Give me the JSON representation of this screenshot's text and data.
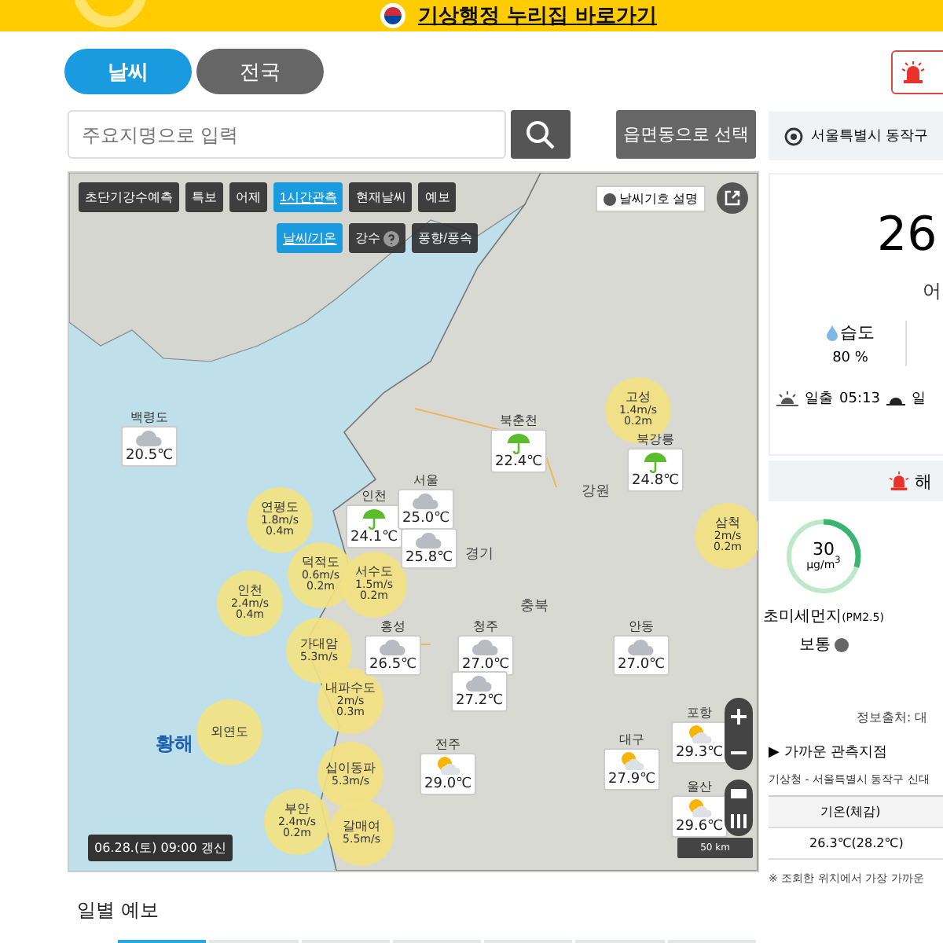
{
  "banner": {
    "link": "기상행정 누리집 바로가기"
  },
  "tabs": [
    {
      "label": "날씨",
      "selected": true
    },
    {
      "label": "전국",
      "selected": false
    }
  ],
  "search": {
    "placeholder": "주요지명으로 입력"
  },
  "region_button": "읍면동으로 선택",
  "location": "서울특별시 동작구",
  "map": {
    "toolbar": [
      {
        "label": "초단기강수예측",
        "selected": false
      },
      {
        "label": "특보",
        "selected": false
      },
      {
        "label": "어제",
        "selected": false
      },
      {
        "label": "1시간관측",
        "selected": true
      },
      {
        "label": "현재날씨",
        "selected": false
      },
      {
        "label": "예보",
        "selected": false
      }
    ],
    "subtoolbar": [
      {
        "label": "날씨/기온",
        "selected": true,
        "help": false
      },
      {
        "label": "강수",
        "selected": false,
        "help": true
      },
      {
        "label": "풍향/풍속",
        "selected": false,
        "help": false
      }
    ],
    "legend_button": "날씨기호 설명",
    "stations": [
      {
        "name": "백령도",
        "temp": "20.5℃",
        "kind": "cloudy"
      },
      {
        "name": "북춘천",
        "temp": "22.4℃",
        "kind": "rain"
      },
      {
        "name": "북강릉",
        "temp": "24.8℃",
        "kind": "rain"
      },
      {
        "name": "인천",
        "temp": "24.1℃",
        "kind": "rain"
      },
      {
        "name": "서울",
        "temp": "25.0℃",
        "kind": "cloudy"
      },
      {
        "temp": "25.8℃",
        "kind": "cloudy"
      },
      {
        "name": "홍성",
        "temp": "26.5℃",
        "kind": "cloudy"
      },
      {
        "name": "청주",
        "temp": "27.0℃",
        "kind": "cloudy"
      },
      {
        "name": "안동",
        "temp": "27.0℃",
        "kind": "cloudy"
      },
      {
        "temp": "27.2℃",
        "kind": "cloudy"
      },
      {
        "name": "전주",
        "temp": "29.0℃",
        "kind": "partly_sunny"
      },
      {
        "name": "대구",
        "temp": "27.9℃",
        "kind": "partly_sunny"
      },
      {
        "name": "포항",
        "temp": "29.3℃",
        "kind": "partly_sunny"
      },
      {
        "name": "울산",
        "temp": "29.6℃",
        "kind": "partly_sunny"
      }
    ],
    "buoys": [
      {
        "name": "고성",
        "wind": "1.4m/s",
        "wave": "0.2m"
      },
      {
        "name": "삼척",
        "wind": "2m/s",
        "wave": "0.2m"
      },
      {
        "name": "연평도",
        "wind": "1.8m/s",
        "wave": "0.4m"
      },
      {
        "name": "덕적도",
        "wind": "0.6m/s",
        "wave": "0.2m"
      },
      {
        "name": "서수도",
        "wind": "1.5m/s",
        "wave": "0.2m"
      },
      {
        "name": "인천",
        "wind": "2.4m/s",
        "wave": "0.4m"
      },
      {
        "name": "가대암",
        "wind": "5.3m/s"
      },
      {
        "name": "내파수도",
        "wind": "2m/s",
        "wave": "0.3m"
      },
      {
        "name": "외연도"
      },
      {
        "name": "십이동파",
        "wind": "5.3m/s"
      },
      {
        "name": "부안",
        "wind": "2.4m/s",
        "wave": "0.2m"
      },
      {
        "name": "갈매여",
        "wind": "5.5m/s"
      }
    ],
    "regions": [
      "황해",
      "강원",
      "경기",
      "충북"
    ],
    "scale": "50 km",
    "updated": "06.28.(토) 09:00 갱신"
  },
  "current": {
    "temperature": "26",
    "condition": "어",
    "humidity_label": "습도",
    "humidity": "80 %",
    "sunrise_label": "일출",
    "sunrise": "05:13",
    "sunset_label": "일"
  },
  "alert_bar": "해",
  "air": {
    "value": "30",
    "unit": "μg/m$^{3}$",
    "level": 0.3,
    "color": "#3cb371",
    "label": "초미세먼지",
    "label_sub": "(PM2.5)",
    "status": "보통"
  },
  "source": "정보출처: 대",
  "nearby": {
    "heading": "▶ 가까운 관측지점",
    "station": "기상청 - 서울특별시 동작구 신대",
    "column": "기온(체감)",
    "value": "26.3℃(28.2℃)",
    "note": "※ 조회한 위치에서 가장 가까운"
  },
  "daily": {
    "heading": "일별 예보",
    "tabs": [
      {
        "selected": true
      },
      {
        "selected": false
      },
      {
        "selected": false
      },
      {
        "selected": false
      },
      {
        "selected": false
      },
      {
        "selected": false
      },
      {
        "selected": false
      }
    ]
  }
}
